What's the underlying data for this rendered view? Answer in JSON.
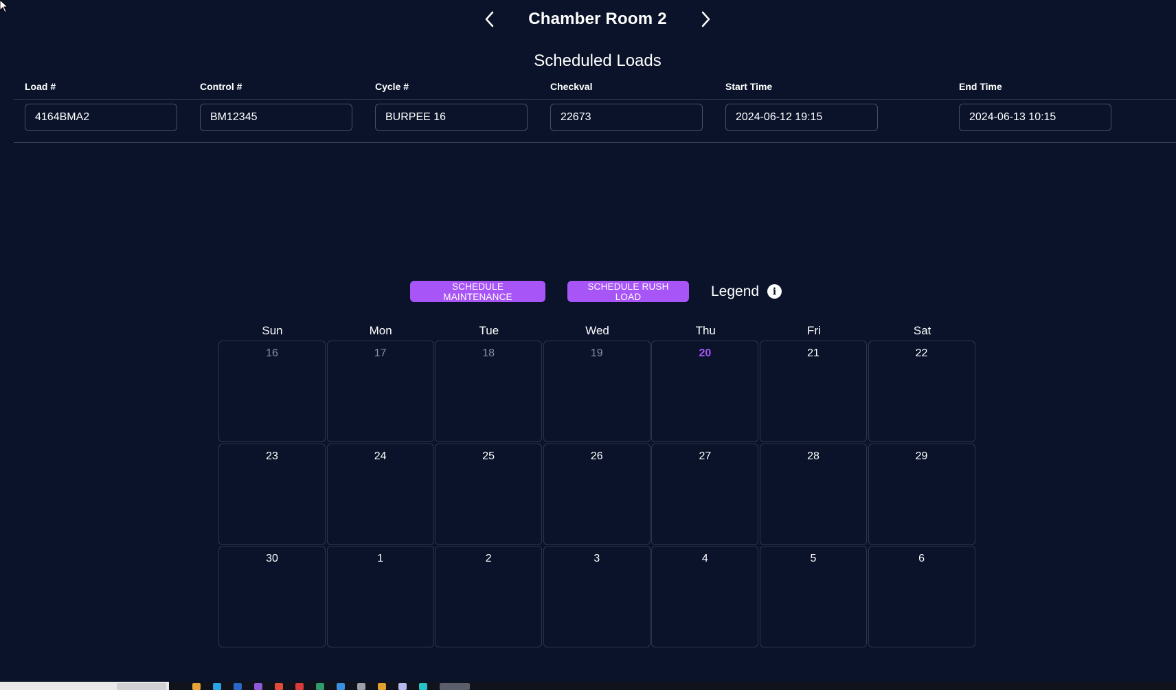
{
  "header": {
    "title": "Chamber Room 2",
    "prev_icon": "chevron-left-icon",
    "next_icon": "chevron-right-icon"
  },
  "scheduled_loads": {
    "title": "Scheduled Loads",
    "columns": [
      "Load #",
      "Control #",
      "Cycle #",
      "Checkval",
      "Start Time",
      "End Time"
    ],
    "rows": [
      [
        "4164BMA2",
        "BM12345",
        "BURPEE 16",
        "22673",
        "2024-06-12 19:15",
        "2024-06-13 10:15"
      ]
    ]
  },
  "actions": {
    "maintenance_label": "SCHEDULE MAINTENANCE",
    "rush_label": "SCHEDULE RUSH LOAD",
    "legend_label": "Legend",
    "info_icon": "info-icon"
  },
  "calendar": {
    "weekdays": [
      "Sun",
      "Mon",
      "Tue",
      "Wed",
      "Thu",
      "Fri",
      "Sat"
    ],
    "weeks": [
      [
        "16",
        "17",
        "18",
        "19",
        "20",
        "21",
        "22"
      ],
      [
        "23",
        "24",
        "25",
        "26",
        "27",
        "28",
        "29"
      ],
      [
        "30",
        "1",
        "2",
        "3",
        "4",
        "5",
        "6"
      ]
    ],
    "today": "20"
  },
  "colors": {
    "background": "#0a132a",
    "accent": "#a855f7",
    "muted_text": "#8b8fa0"
  }
}
